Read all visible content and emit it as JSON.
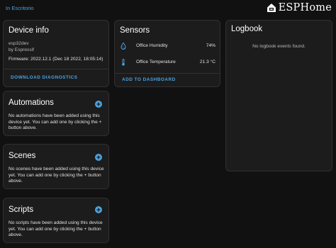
{
  "header": {
    "breadcrumb": "In Escritorio",
    "brand": "ESPHome"
  },
  "device_info": {
    "title": "Device info",
    "model": "esp32dev",
    "manufacturer": "by Espressif",
    "firmware": "Firmware: 2022.12.1 (Dec 18 2022, 18:05:14)",
    "action_label": "DOWNLOAD DIAGNOSTICS"
  },
  "sensors": {
    "title": "Sensors",
    "items": [
      {
        "name": "Office Humidity",
        "value": "74%",
        "icon": "water-percent-icon"
      },
      {
        "name": "Office Temperature",
        "value": "21.3 °C",
        "icon": "thermometer-icon"
      }
    ],
    "action_label": "ADD TO DASHBOARD"
  },
  "logbook": {
    "title": "Logbook",
    "empty_message": "No logbook events found."
  },
  "automations": {
    "title": "Automations",
    "description": "No automations have been added using this device yet. You can add one by clicking the + button above."
  },
  "scenes": {
    "title": "Scenes",
    "description": "No scenes have been added using this device yet. You can add one by clicking the + button above."
  },
  "scripts": {
    "title": "Scripts",
    "description": "No scripts have been added using this device yet. You can add one by clicking the + button above."
  },
  "colors": {
    "background": "#111111",
    "card": "#1c1c1c",
    "accent": "#4aa3e0",
    "text": "#e1e1e1",
    "muted": "#b9b9b9"
  }
}
